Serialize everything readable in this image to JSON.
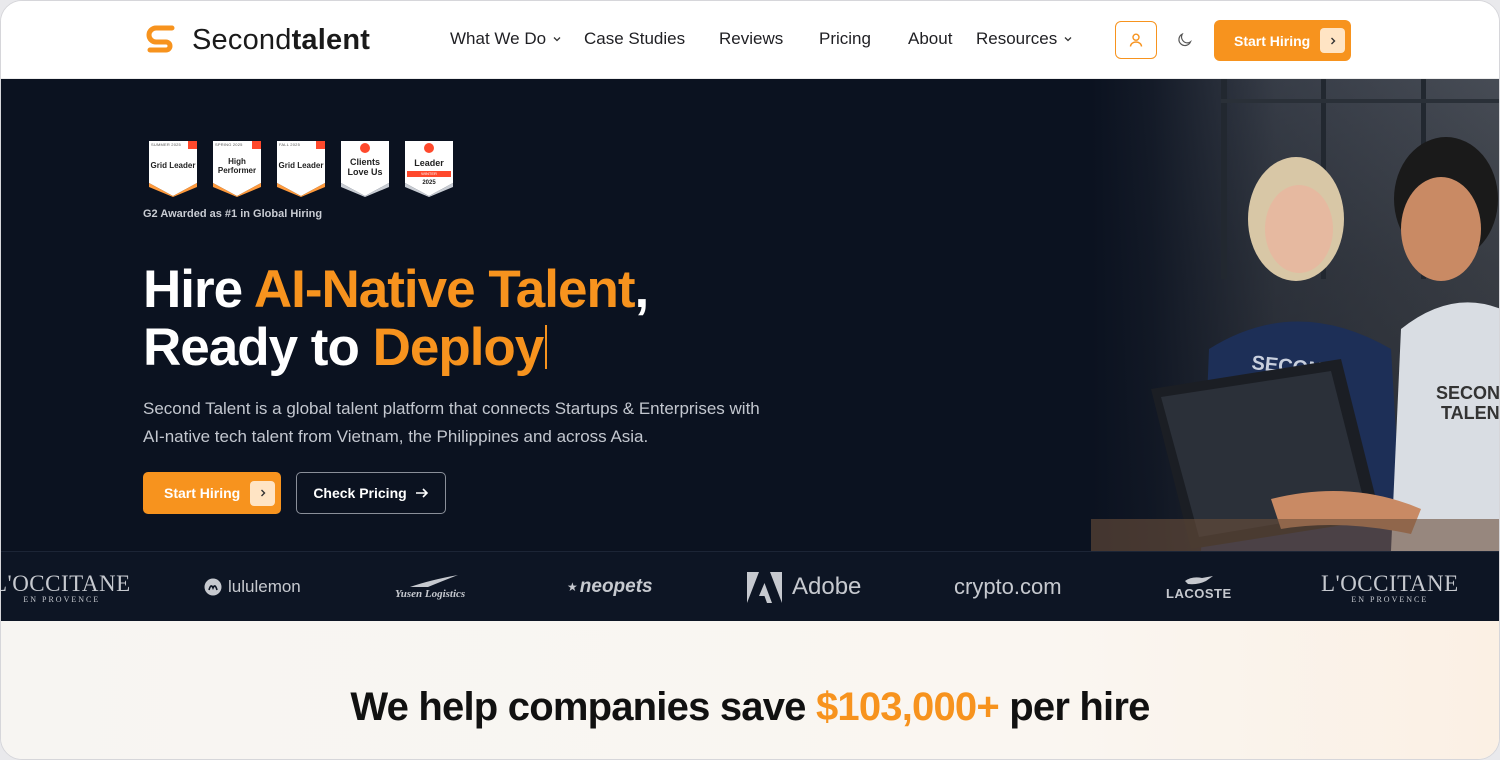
{
  "brand": {
    "name_light": "Second",
    "name_bold": "talent",
    "accent": "#f7931e"
  },
  "nav": {
    "links": [
      {
        "label": "What We Do",
        "dropdown": true
      },
      {
        "label": "Case Studies",
        "dropdown": false
      },
      {
        "label": "Reviews",
        "dropdown": false
      },
      {
        "label": "Pricing",
        "dropdown": false
      },
      {
        "label": "About",
        "dropdown": false
      },
      {
        "label": "Resources",
        "dropdown": true
      }
    ],
    "cta_label": "Start Hiring",
    "icons": [
      "user-icon",
      "moon-icon",
      "chevron-right-icon"
    ]
  },
  "hero": {
    "badges": [
      {
        "season": "SUMMER 2025",
        "title": "Grid Leader",
        "year": ""
      },
      {
        "season": "SPRING 2025",
        "title": "High Performer",
        "year": ""
      },
      {
        "season": "FALL 2025",
        "title": "Grid Leader",
        "year": ""
      },
      {
        "season": "",
        "title": "Clients Love Us",
        "year": ""
      },
      {
        "season": "",
        "title": "Leader",
        "ribbon": "WINTER",
        "year": "2025"
      }
    ],
    "g2_caption": "G2 Awarded as #1 in Global Hiring",
    "headline": {
      "line1_white": "Hire ",
      "line1_orange": "AI-Native Talent",
      "line1_end": ",",
      "line2_white": "Ready to ",
      "line2_orange": "Deploy"
    },
    "subtitle": "Second Talent is a global talent platform that connects Startups & Enterprises with AI-native tech talent from Vietnam, the Philippines and across Asia.",
    "primary_cta": "Start Hiring",
    "secondary_cta": "Check Pricing",
    "photo_shirt_text": [
      "SECOND",
      "TALENT"
    ]
  },
  "clients": [
    {
      "name": "L'OCCITANE",
      "sub": "EN PROVENCE"
    },
    {
      "name": "lululemon",
      "sub": ""
    },
    {
      "name": "Yusen Logistics",
      "sub": ""
    },
    {
      "name": "neopets",
      "sub": ""
    },
    {
      "name": "Adobe",
      "sub": ""
    },
    {
      "name": "crypto.com",
      "sub": ""
    },
    {
      "name": "LACOSTE",
      "sub": ""
    },
    {
      "name": "L'OCCITANE",
      "sub": "EN PROVENCE"
    }
  ],
  "savings": {
    "prefix": "We help companies save ",
    "amount": "$103,000+",
    "suffix": " per hire"
  }
}
